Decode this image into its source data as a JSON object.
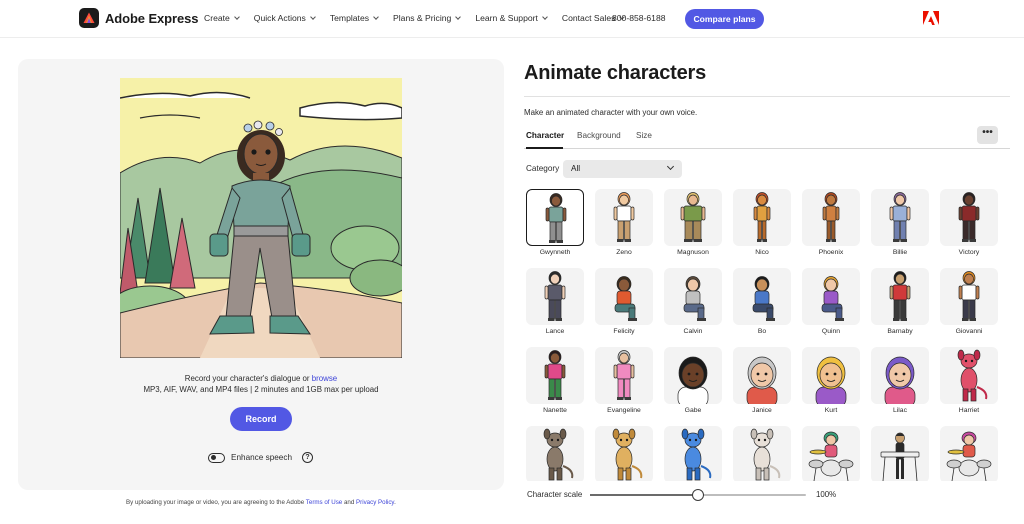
{
  "brand": {
    "name": "Adobe Express"
  },
  "nav": {
    "items": [
      {
        "label": "Create"
      },
      {
        "label": "Quick Actions"
      },
      {
        "label": "Templates"
      },
      {
        "label": "Plans & Pricing"
      },
      {
        "label": "Learn & Support"
      },
      {
        "label": "Contact Sales"
      }
    ],
    "phone": "800-858-6188",
    "cta_label": "Compare plans"
  },
  "upload": {
    "line1_text": "Record your character's dialogue or ",
    "browse_label": "browse",
    "line2_text": "MP3, AIF, WAV, and MP4 files | 2 minutes and 1GB max per upload",
    "record_label": "Record",
    "enhance_label": "Enhance speech",
    "enhance_on": false,
    "help_glyph": "?"
  },
  "terms": {
    "prefix": "By uploading your image or video, you are agreeing to the Adobe ",
    "terms_link": "Terms of Use",
    "and": " and ",
    "privacy_link": "Privacy Policy",
    "suffix": "."
  },
  "panel": {
    "title": "Animate characters",
    "subtitle": "Make an animated character with your own voice.",
    "tabs": [
      {
        "label": "Character"
      },
      {
        "label": "Background"
      },
      {
        "label": "Size"
      }
    ],
    "more_label": "•••",
    "category_label": "Category",
    "category_value": "All"
  },
  "characters": [
    {
      "name": "Gwynneth",
      "selected": true,
      "skin": "#8a5a3c",
      "hair": "#3a2a20",
      "shirt": "#7aa39a",
      "pants": "#8f8f8f",
      "shape": "tall"
    },
    {
      "name": "Zeno",
      "skin": "#f0c9a0",
      "hair": "#e89a5a",
      "shirt": "#ffffff",
      "pants": "#c9a070",
      "shape": "tall"
    },
    {
      "name": "Magnuson",
      "skin": "#e8b890",
      "hair": "#e0c070",
      "shirt": "#7a9a4a",
      "pants": "#a88a5a",
      "shape": "wide"
    },
    {
      "name": "Nico",
      "skin": "#d88a40",
      "hair": "#c0502a",
      "shirt": "#e0a040",
      "pants": "#b86a2a",
      "shape": "slim"
    },
    {
      "name": "Phoenix",
      "skin": "#c07a40",
      "hair": "#b04a20",
      "shirt": "#d08040",
      "pants": "#9a5a2a",
      "shape": "slim"
    },
    {
      "name": "Billie",
      "skin": "#f0c8a8",
      "hair": "#8a6a9a",
      "shirt": "#9ab0d8",
      "pants": "#7080b0",
      "shape": "tall"
    },
    {
      "name": "Victory",
      "skin": "#6a4030",
      "hair": "#2a2020",
      "shirt": "#8a2a2a",
      "pants": "#3a2a2a",
      "shape": "tall"
    },
    {
      "name": "Lance",
      "skin": "#f0d0b8",
      "hair": "#2a2a2a",
      "shirt": "#5a5a6a",
      "pants": "#4a4a5a",
      "shape": "tall"
    },
    {
      "name": "Felicity",
      "skin": "#8a5a3a",
      "hair": "#3a2a1a",
      "shirt": "#e05a30",
      "pants": "#4a7a7a",
      "shape": "sit"
    },
    {
      "name": "Calvin",
      "skin": "#f0c8a8",
      "hair": "#5a4a3a",
      "shirt": "#c0c0c0",
      "pants": "#5a6a8a",
      "shape": "sit"
    },
    {
      "name": "Bo",
      "skin": "#c8905a",
      "hair": "#1a1a1a",
      "shirt": "#4a78c8",
      "pants": "#3a4a6a",
      "shape": "sit"
    },
    {
      "name": "Quinn",
      "skin": "#f0c8a8",
      "hair": "#e0a030",
      "shirt": "#9a5ac8",
      "pants": "#4a5a8a",
      "shape": "sit"
    },
    {
      "name": "Barnaby",
      "skin": "#c8a070",
      "hair": "#1a1a1a",
      "shirt": "#d03a3a",
      "pants": "#3a3a3a",
      "shape": "tall"
    },
    {
      "name": "Giovanni",
      "skin": "#c08050",
      "hair": "#e08a20",
      "shirt": "#ffffff",
      "pants": "#3a3a4a",
      "shape": "tall"
    },
    {
      "name": "Nanette",
      "skin": "#8a5a3a",
      "hair": "#2a1a1a",
      "shirt": "#e04a8a",
      "pants": "#3a8a4a",
      "shape": "tall"
    },
    {
      "name": "Evangeline",
      "skin": "#e8c0a0",
      "hair": "#c8c8c8",
      "shirt": "#f08ac0",
      "pants": "#f08ac0",
      "shape": "tall"
    },
    {
      "name": "Gabe",
      "skin": "#6a4028",
      "hair": "#1a1a1a",
      "shirt": "#ffffff",
      "pants": "#2a2a2a",
      "shape": "head"
    },
    {
      "name": "Janice",
      "skin": "#f0c8a8",
      "hair": "#c8c8c8",
      "shirt": "#e05a4a",
      "pants": "#5a5a5a",
      "shape": "head"
    },
    {
      "name": "Kurt",
      "skin": "#f0c090",
      "hair": "#f0c040",
      "shirt": "#9a5ac8",
      "pants": "#5a5a5a",
      "shape": "head"
    },
    {
      "name": "Lilac",
      "skin": "#f0c8a8",
      "hair": "#7a5ac8",
      "shirt": "#e05a8a",
      "pants": "#5a5a5a",
      "shape": "head"
    },
    {
      "name": "Harriet",
      "skin": "#e0506a",
      "hair": "#c02a4a",
      "shirt": "#e0506a",
      "pants": "#c02a4a",
      "shape": "creature"
    },
    {
      "name": "",
      "skin": "#8a7a6a",
      "hair": "#6a5a4a",
      "shirt": "#8a7a6a",
      "pants": "#6a5a4a",
      "shape": "creature"
    },
    {
      "name": "",
      "skin": "#e0b060",
      "hair": "#c08a3a",
      "shirt": "#e0b060",
      "pants": "#c08a3a",
      "shape": "creature"
    },
    {
      "name": "",
      "skin": "#4a8ae0",
      "hair": "#2a6ac0",
      "shirt": "#4a8ae0",
      "pants": "#2a6ac0",
      "shape": "creature"
    },
    {
      "name": "",
      "skin": "#e8e0d8",
      "hair": "#c8c0b8",
      "shirt": "#e8e0d8",
      "pants": "#c8c0b8",
      "shape": "creature"
    },
    {
      "name": "",
      "skin": "#f0c8a8",
      "hair": "#3aa07a",
      "shirt": "#e05a7a",
      "pants": "#4a7ac8",
      "shape": "drums"
    },
    {
      "name": "",
      "skin": "#c8a070",
      "hair": "#2a2a2a",
      "shirt": "#2a2a2a",
      "pants": "#2a2a2a",
      "shape": "keys"
    },
    {
      "name": "",
      "skin": "#f0c8a8",
      "hair": "#c84aa0",
      "shirt": "#e05a4a",
      "pants": "#4a4ac8",
      "shape": "drums"
    }
  ],
  "scale": {
    "label": "Character scale",
    "value_text": "100%",
    "fraction": 0.5
  },
  "colors": {
    "accent": "#5258e4",
    "link": "#3d44d8",
    "adobe_red": "#eb1000"
  }
}
